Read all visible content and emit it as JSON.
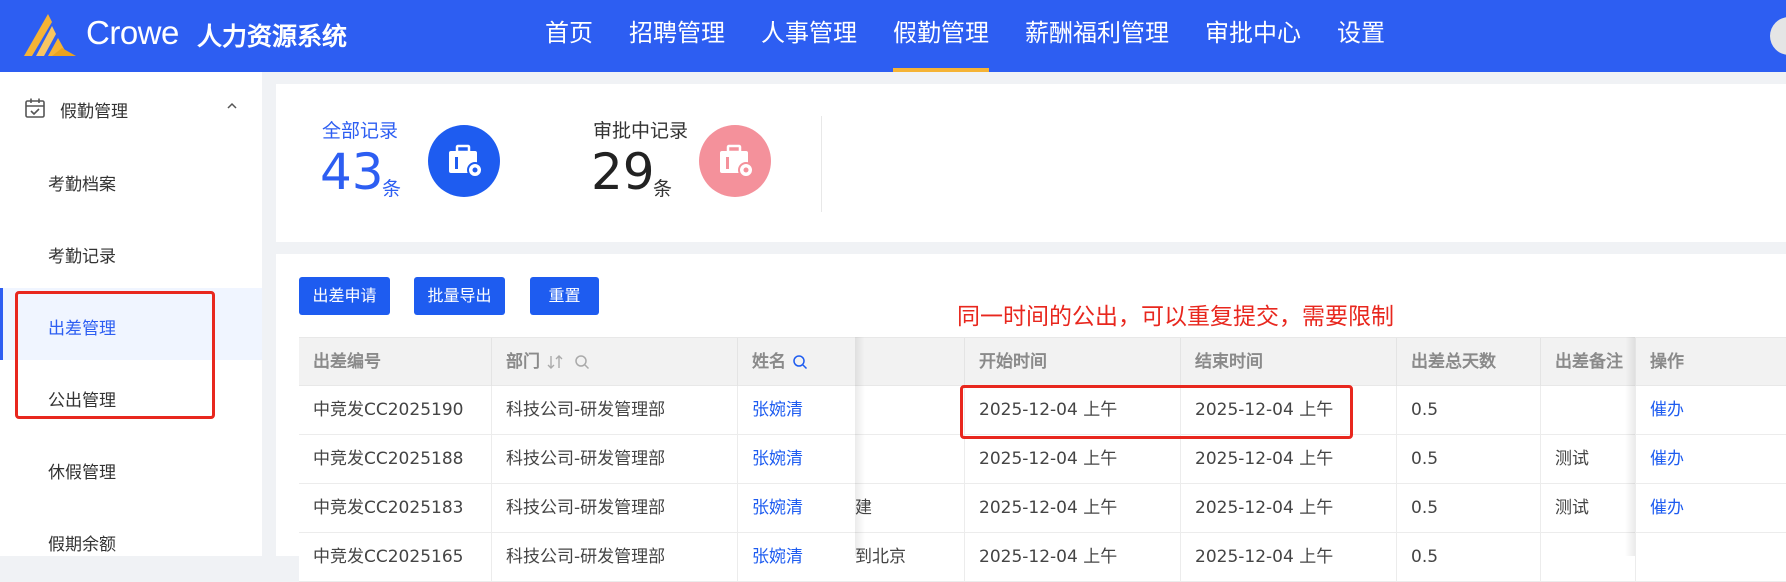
{
  "header": {
    "brand": "Crowe",
    "system_name": "人力资源系统",
    "nav": [
      "首页",
      "招聘管理",
      "人事管理",
      "假勤管理",
      "薪酬福利管理",
      "审批中心",
      "设置"
    ],
    "active_nav": "假勤管理",
    "accent_color": "#2d5ef2",
    "active_underline_color": "#f5b335"
  },
  "sidebar": {
    "group_label": "假勤管理",
    "group_icon": "calendar-icon",
    "items": [
      {
        "label": "考勤档案"
      },
      {
        "label": "考勤记录"
      },
      {
        "label": "出差管理",
        "active": true
      },
      {
        "label": "公出管理"
      },
      {
        "label": "休假管理"
      },
      {
        "label": "假期余额"
      }
    ]
  },
  "stats": [
    {
      "title": "全部记录",
      "value": "43",
      "unit": "条",
      "icon": "briefcase-gear-icon",
      "color": "#1e5cf0"
    },
    {
      "title": "审批中记录",
      "value": "29",
      "unit": "条",
      "icon": "briefcase-gear-icon",
      "color": "#f4919b"
    }
  ],
  "toolbar": {
    "apply_label": "出差申请",
    "export_label": "批量导出",
    "reset_label": "重置"
  },
  "annotation": {
    "text": "同一时间的公出，可以重复提交，需要限制",
    "color": "#e8271e"
  },
  "table": {
    "columns": [
      "出差编号",
      "部门",
      "姓名",
      "",
      "开始时间",
      "结束时间",
      "出差总天数",
      "出差备注",
      "操作"
    ],
    "rows": [
      {
        "id": "中竞发CC2025190",
        "dept": "科技公司-研发管理部",
        "name": "张婉清",
        "hidden": "",
        "start": "2025-12-04 上午",
        "end": "2025-12-04 上午",
        "days": "0.5",
        "remark": "",
        "action": "催办"
      },
      {
        "id": "中竞发CC2025188",
        "dept": "科技公司-研发管理部",
        "name": "张婉清",
        "hidden": "",
        "start": "2025-12-04 上午",
        "end": "2025-12-04 上午",
        "days": "0.5",
        "remark": "测试",
        "action": "催办"
      },
      {
        "id": "中竞发CC2025183",
        "dept": "科技公司-研发管理部",
        "name": "张婉清",
        "hidden": "建",
        "start": "2025-12-04 上午",
        "end": "2025-12-04 上午",
        "days": "0.5",
        "remark": "测试",
        "action": "催办"
      },
      {
        "id": "中竞发CC2025165",
        "dept": "科技公司-研发管理部",
        "name": "张婉清",
        "hidden": "到北京",
        "start": "2025-12-04 上午",
        "end": "2025-12-04 上午",
        "days": "0.5",
        "remark": "",
        "action": ""
      }
    ]
  }
}
